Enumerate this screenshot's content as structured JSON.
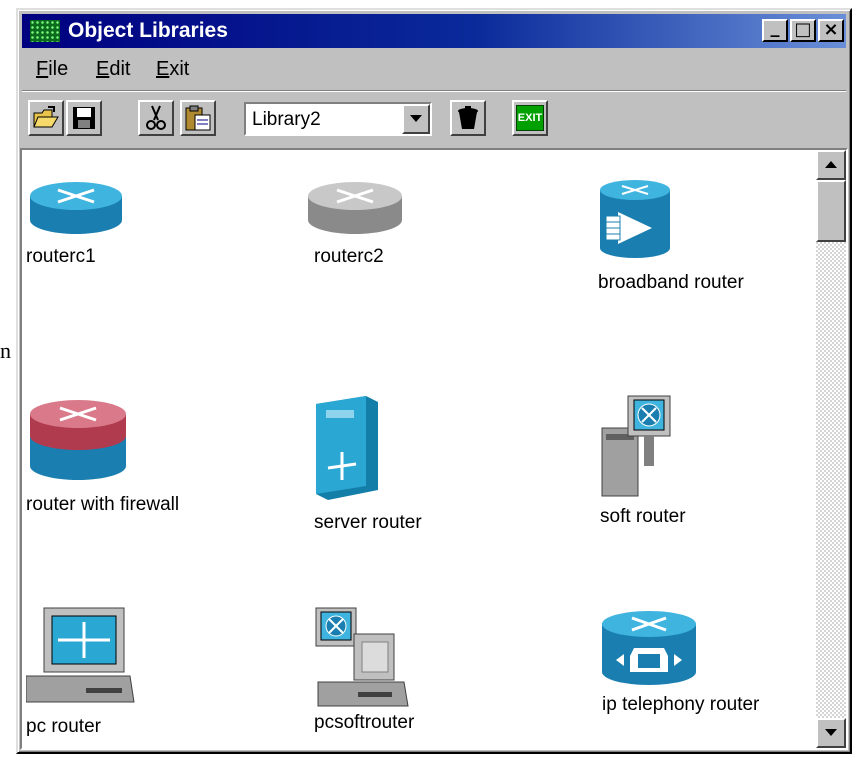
{
  "stray_char": "n",
  "window": {
    "title": "Object Libraries",
    "controls": {
      "minimize": "_",
      "maximize": "□",
      "close": "×"
    }
  },
  "menu": {
    "file": "File",
    "edit": "Edit",
    "exit": "Exit"
  },
  "toolbar": {
    "library_select": "Library2",
    "exit_label": "EXIT"
  },
  "icons": {
    "open": "open-folder-icon",
    "save": "save-disk-icon",
    "cut": "scissors-icon",
    "paste": "clipboard-icon",
    "delete": "trash-can-icon",
    "exit": "exit-icon"
  },
  "library_items": [
    {
      "label": "routerc1",
      "icon": "router-blue-icon"
    },
    {
      "label": "routerc2",
      "icon": "router-gray-icon"
    },
    {
      "label": "broadband router",
      "icon": "broadband-router-icon"
    },
    {
      "label": "router with firewall",
      "icon": "router-firewall-icon"
    },
    {
      "label": "server router",
      "icon": "server-router-icon"
    },
    {
      "label": "soft router",
      "icon": "soft-router-icon"
    },
    {
      "label": "pc router",
      "icon": "pc-router-icon"
    },
    {
      "label": "pcsoftrouter",
      "icon": "pc-soft-router-icon"
    },
    {
      "label": "ip telephony router",
      "icon": "ip-telephony-router-icon"
    }
  ],
  "colors": {
    "titlebar": "#000080",
    "router_blue": "#1d8fc0",
    "router_red": "#c04a5a",
    "exit_green": "#00a000"
  }
}
